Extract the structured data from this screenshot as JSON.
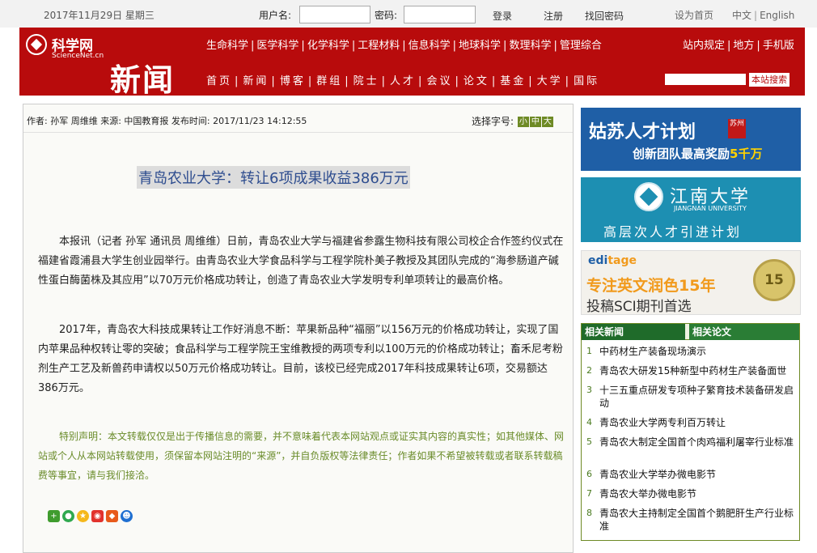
{
  "topbar": {
    "date": "2017年11月29日 星期三",
    "username_label": "用户名:",
    "password_label": "密码:",
    "login": "登录",
    "register": "注册",
    "recover": "找回密码",
    "set_home": "设为首页",
    "lang_cn": "中文",
    "lang_en": "English"
  },
  "header": {
    "logo_cn": "科学网",
    "logo_en": "ScienceNet.cn",
    "news": "新闻",
    "nav_top": [
      "生命科学",
      "医学科学",
      "化学科学",
      "工程材料",
      "信息科学",
      "地球科学",
      "数理科学",
      "管理综合"
    ],
    "nav_right": [
      "站内规定",
      "地方",
      "手机版"
    ],
    "nav_bottom": [
      "首页",
      "新闻",
      "博客",
      "群组",
      "院士",
      "人才",
      "会议",
      "论文",
      "基金",
      "大学",
      "国际"
    ],
    "search_button": "本站搜索"
  },
  "article": {
    "meta": "作者: 孙军 周维维 来源: 中国教育报 发布时间: 2017/11/23 14:12:55",
    "font_label": "选择字号:",
    "font_sizes": [
      "小",
      "中",
      "大"
    ],
    "title": "青岛农业大学：转让6项成果收益386万元",
    "p1": "本报讯（记者 孙军 通讯员 周维维）日前，青岛农业大学与福建省参露生物科技有限公司校企合作签约仪式在福建省霞浦县大学生创业园举行。由青岛农业大学食品科学与工程学院朴美子教授及其团队完成的“海参肠道产碱性蛋白酶菌株及其应用”以70万元价格成功转让，创造了青岛农业大学发明专利单项转让的最高价格。",
    "p2": "2017年，青岛农大科技成果转让工作好消息不断：苹果新品种“福丽”以156万元的价格成功转让，实现了国内苹果品种权转让零的突破；食品科学与工程学院王宝维教授的两项专利以100万元的价格成功转让；畜禾尼考粉剂生产工艺及新兽药申请权以50万元价格成功转让。目前，该校已经完成2017年科技成果转让6项，交易额达386万元。",
    "notice": "特别声明：本文转载仅仅是出于传播信息的需要，并不意味着代表本网站观点或证实其内容的真实性；如其他媒体、网站或个人从本网站转载使用，须保留本网站注明的“来源”，并自负版权等法律责任；作者如果不希望被转载或者联系转载稿费等事宜，请与我们接洽。"
  },
  "ads": {
    "ad1_title": "姑苏人才计划",
    "ad1_tag": "苏州",
    "ad1_sub_pre": "创新团队最高奖励",
    "ad1_sub_amt": "5千万",
    "ad2_uni": "江南大学",
    "ad2_uni_en": "JIANGNAN UNIVERSITY",
    "ad2_sub": "高层次人才引进计划",
    "ad3_brand_a": "edi",
    "ad3_brand_b": "tage",
    "ad3_l1": "专注英文润色15年",
    "ad3_l2": "投稿SCI期刊首选",
    "ad3_badge": "15"
  },
  "related": {
    "tab_news": "相关新闻",
    "tab_papers": "相关论文",
    "items": [
      {
        "n": "1",
        "t": "中药材生产装备现场演示"
      },
      {
        "n": "2",
        "t": "青岛农大研发15种新型中药材生产装备面世"
      },
      {
        "n": "3",
        "t": "十三五重点研发专项种子繁育技术装备研发启动"
      },
      {
        "n": "4",
        "t": "青岛农业大学两专利百万转让"
      },
      {
        "n": "5",
        "t": "青岛农大制定全国首个肉鸡福利屠宰行业标准"
      },
      {
        "n": "6",
        "t": "青岛农业大学举办微电影节"
      },
      {
        "n": "7",
        "t": "青岛农大举办微电影节"
      },
      {
        "n": "8",
        "t": "青岛农大主持制定全国首个鹅肥肝生产行业标准"
      }
    ]
  },
  "colors": {
    "header_red": "#b80b0c",
    "accent_green": "#6e8a25",
    "link_blue": "#2e4d8f"
  }
}
